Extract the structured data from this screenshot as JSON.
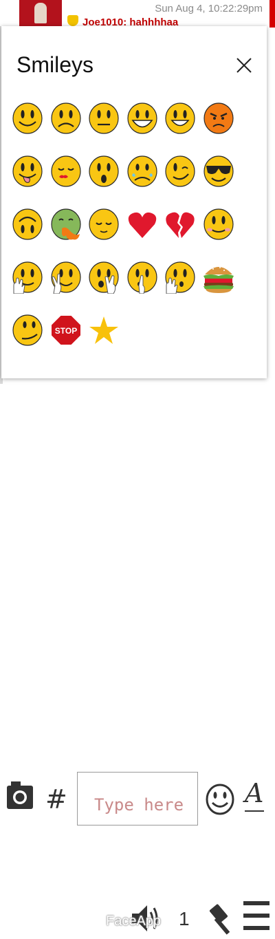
{
  "chat": {
    "timestamp": "Sun Aug 4, 10:22:29pm",
    "partial_line": "Joe1010: hahhhhaa"
  },
  "smileys_panel": {
    "title": "Smileys",
    "close_label": "X",
    "items": [
      {
        "name": "smile-icon"
      },
      {
        "name": "frown-icon"
      },
      {
        "name": "neutral-icon"
      },
      {
        "name": "big-grin-icon"
      },
      {
        "name": "grin-icon"
      },
      {
        "name": "angry-icon"
      },
      {
        "name": "tongue-out-icon"
      },
      {
        "name": "kiss-icon"
      },
      {
        "name": "surprised-icon"
      },
      {
        "name": "crying-icon"
      },
      {
        "name": "wink-icon"
      },
      {
        "name": "cool-sunglasses-icon"
      },
      {
        "name": "upside-down-icon"
      },
      {
        "name": "sick-icon"
      },
      {
        "name": "sleepy-icon"
      },
      {
        "name": "heart-icon"
      },
      {
        "name": "broken-heart-icon"
      },
      {
        "name": "blush-icon"
      },
      {
        "name": "wave-icon"
      },
      {
        "name": "peace-sign-icon"
      },
      {
        "name": "shocked-hand-icon"
      },
      {
        "name": "shush-icon"
      },
      {
        "name": "hand-wave-icon"
      },
      {
        "name": "burger-icon"
      },
      {
        "name": "smirk-icon"
      },
      {
        "name": "stop-sign-icon"
      },
      {
        "name": "star-icon"
      }
    ],
    "stop_text": "STOP"
  },
  "input_bar": {
    "hash_label": "#",
    "placeholder": "Type here",
    "font_label": "A"
  },
  "footer": {
    "watermark": "FaceApp",
    "count": "1"
  },
  "colors": {
    "face_yellow": "#f9c613",
    "face_outline": "#2a2a2a",
    "heart_red": "#e0182d",
    "angry_orange": "#f27a14",
    "sick_green": "#86b85a",
    "stop_red": "#d0141c",
    "star_gold": "#f8c10b"
  }
}
